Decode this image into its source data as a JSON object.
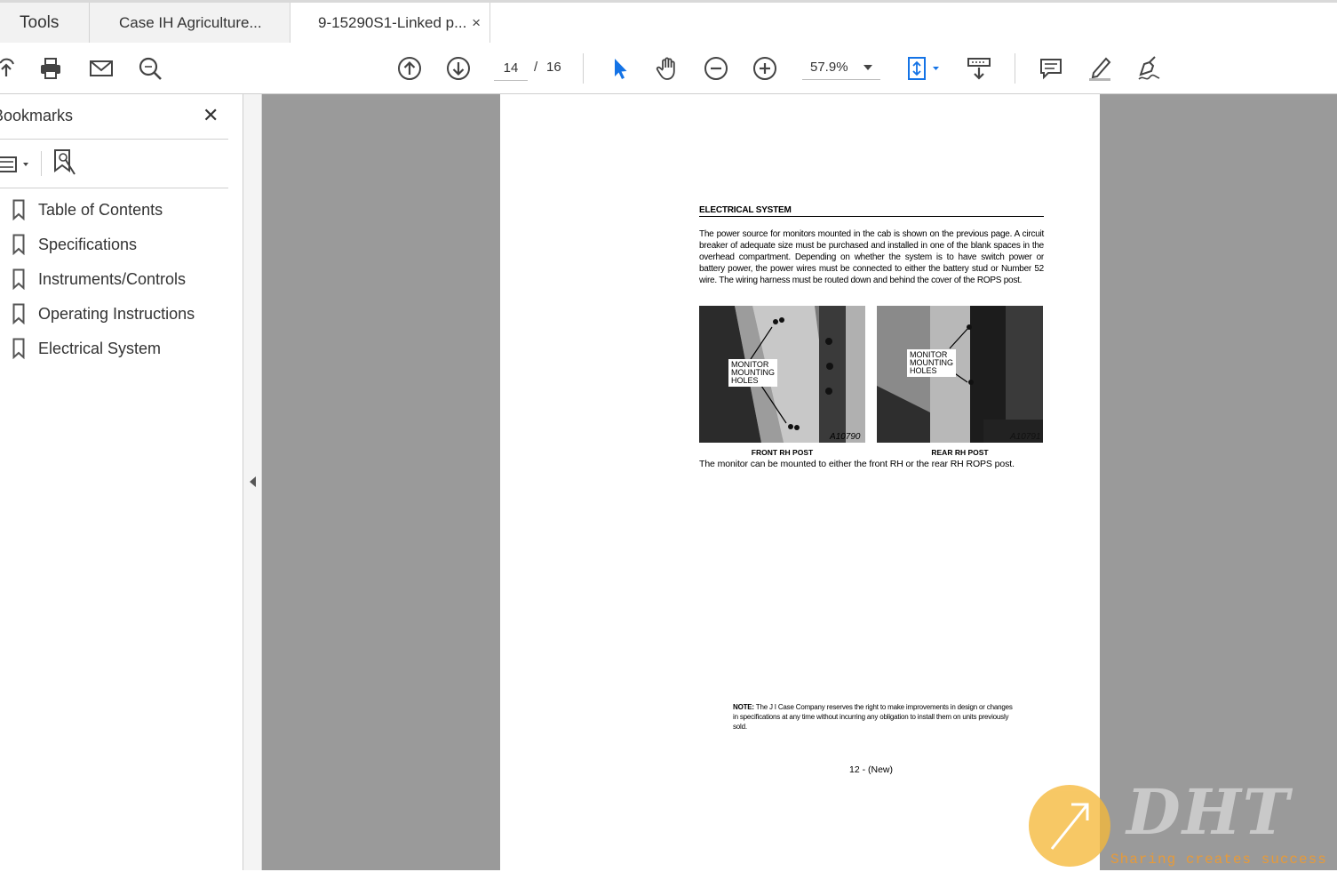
{
  "tabs": {
    "tools_label": "Tools",
    "doc1_label": "Case IH Agriculture...",
    "doc2_label": "9-15290S1-Linked p...",
    "close_glyph": "×"
  },
  "toolbar": {
    "current_page": "14",
    "page_separator": "/",
    "total_pages": "16",
    "zoom": "57.9%",
    "accent_color": "#1473e6"
  },
  "sidebar": {
    "title": "Bookmarks",
    "close_glyph": "✕",
    "bookmarks": [
      {
        "label": "Table of Contents"
      },
      {
        "label": "Specifications"
      },
      {
        "label": "Instruments/Controls"
      },
      {
        "label": "Operating Instructions"
      },
      {
        "label": "Electrical System"
      }
    ]
  },
  "document": {
    "heading": "ELECTRICAL SYSTEM",
    "paragraph": "The power source for monitors mounted in the cab is shown on the previous page. A circuit breaker of adequate size must be purchased and installed in one of the blank spaces in the overhead compartment. Depending on whether the system is to have switch power or battery power, the power wires must be connected to either the battery stud or Number 52 wire. The wiring harness must be routed down and behind the cover of the ROPS post.",
    "photo1": {
      "label_line1": "MONITOR",
      "label_line2": "MOUNTING",
      "label_line3": "HOLES",
      "code": "A10790",
      "caption": "FRONT RH POST"
    },
    "photo2": {
      "label_line1": "MONITOR",
      "label_line2": "MOUNTING",
      "label_line3": "HOLES",
      "code": "A10791",
      "caption": "REAR RH POST"
    },
    "figure_caption": "The monitor can be mounted to either the front RH or the rear RH ROPS post.",
    "note_label": "NOTE:",
    "note_text": "The J I Case Company reserves the right to make improvements in design or changes in specifications at any time without incurring any obligation to install them on units previously sold.",
    "page_number": "12 - (New)"
  },
  "watermark": {
    "brand": "DHT",
    "tagline": "Sharing creates success"
  }
}
